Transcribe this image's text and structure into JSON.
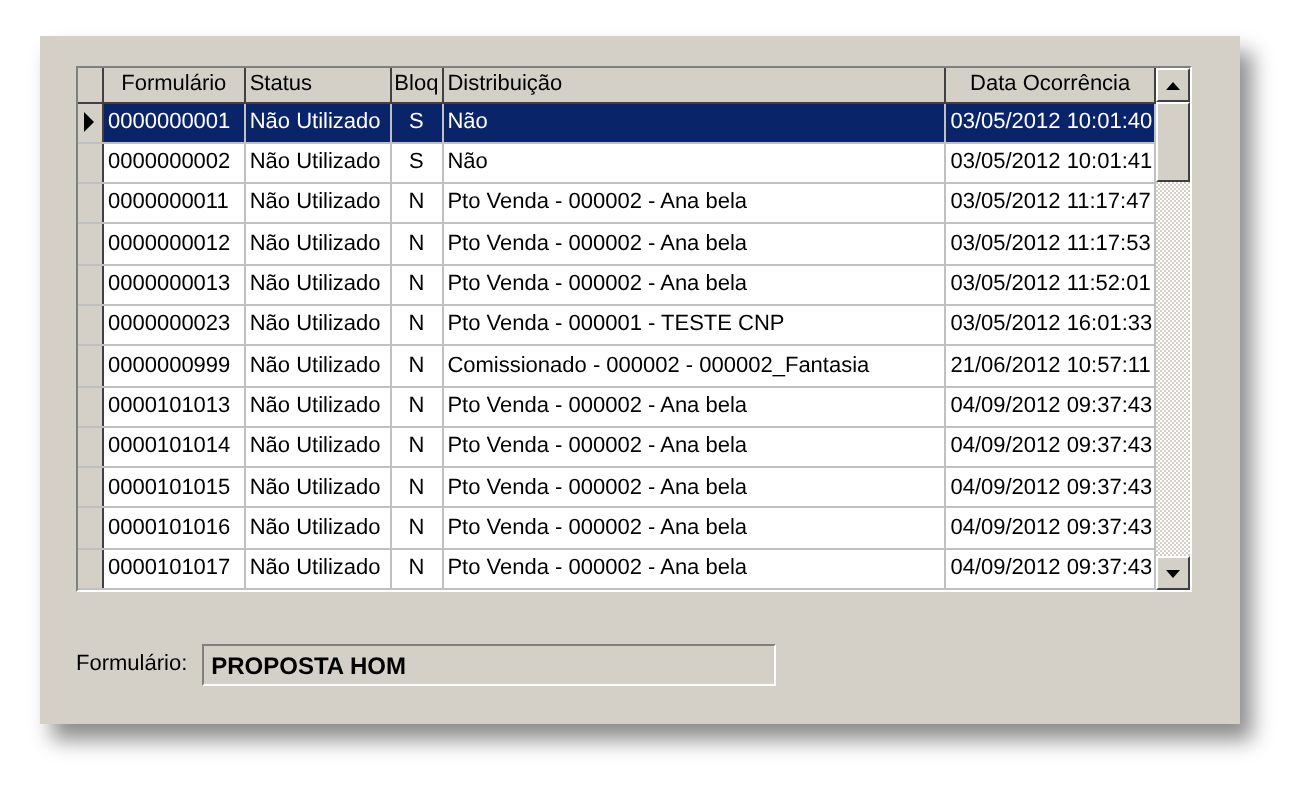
{
  "table": {
    "columns": [
      "Formulário",
      "Status",
      "Bloq",
      "Distribuição",
      "Data Ocorrência"
    ],
    "rows": [
      {
        "selected": true,
        "cells": [
          "0000000001",
          "Não Utilizado",
          "S",
          "Não",
          "03/05/2012 10:01:40"
        ]
      },
      {
        "selected": false,
        "cells": [
          "0000000002",
          "Não Utilizado",
          "S",
          "Não",
          "03/05/2012 10:01:41"
        ]
      },
      {
        "selected": false,
        "cells": [
          "0000000011",
          "Não Utilizado",
          "N",
          "Pto Venda - 000002 - Ana bela",
          "03/05/2012 11:17:47"
        ]
      },
      {
        "selected": false,
        "cells": [
          "0000000012",
          "Não Utilizado",
          "N",
          "Pto Venda - 000002 - Ana bela",
          "03/05/2012 11:17:53"
        ]
      },
      {
        "selected": false,
        "cells": [
          "0000000013",
          "Não Utilizado",
          "N",
          "Pto Venda - 000002 - Ana bela",
          "03/05/2012 11:52:01"
        ]
      },
      {
        "selected": false,
        "cells": [
          "0000000023",
          "Não Utilizado",
          "N",
          "Pto Venda - 000001 - TESTE CNP",
          "03/05/2012 16:01:33"
        ]
      },
      {
        "selected": false,
        "cells": [
          "0000000999",
          "Não Utilizado",
          "N",
          "Comissionado - 000002 - 000002_Fantasia",
          "21/06/2012 10:57:11"
        ]
      },
      {
        "selected": false,
        "cells": [
          "0000101013",
          "Não Utilizado",
          "N",
          "Pto Venda - 000002 - Ana bela",
          "04/09/2012 09:37:43"
        ]
      },
      {
        "selected": false,
        "cells": [
          "0000101014",
          "Não Utilizado",
          "N",
          "Pto Venda - 000002 - Ana bela",
          "04/09/2012 09:37:43"
        ]
      },
      {
        "selected": false,
        "cells": [
          "0000101015",
          "Não Utilizado",
          "N",
          "Pto Venda - 000002 - Ana bela",
          "04/09/2012 09:37:43"
        ]
      },
      {
        "selected": false,
        "cells": [
          "0000101016",
          "Não Utilizado",
          "N",
          "Pto Venda - 000002 - Ana bela",
          "04/09/2012 09:37:43"
        ]
      },
      {
        "selected": false,
        "cells": [
          "0000101017",
          "Não Utilizado",
          "N",
          "Pto Venda - 000002 - Ana bela",
          "04/09/2012 09:37:43"
        ]
      }
    ]
  },
  "field": {
    "label": "Formulário:",
    "value": "PROPOSTA HOM"
  }
}
